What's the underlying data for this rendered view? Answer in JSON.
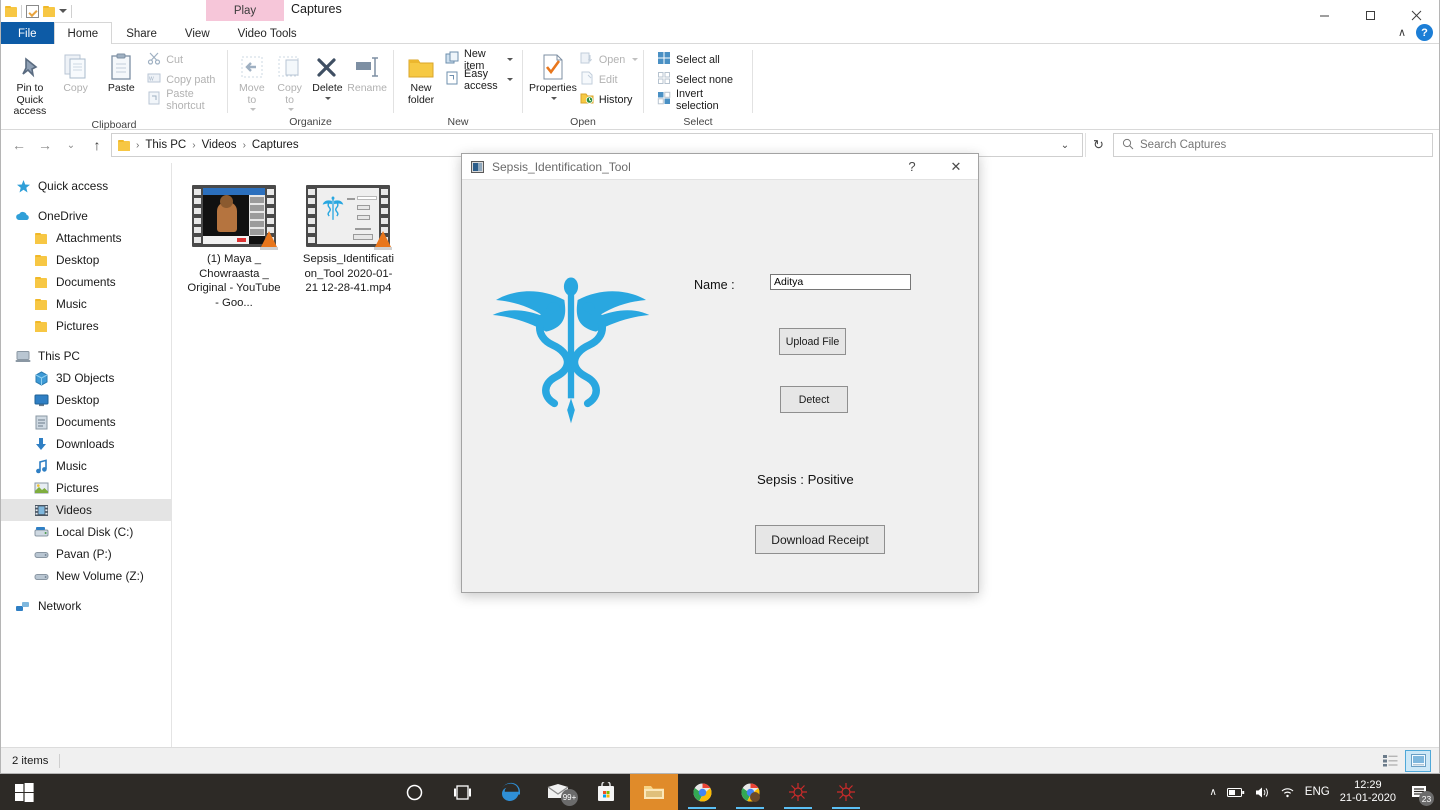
{
  "window": {
    "title": "Captures",
    "contextual_tab_group": "Play",
    "controls": {
      "minimize": "—",
      "maximize": "❐",
      "close": "✕",
      "collapse_ribbon": "∧",
      "help": "?"
    },
    "quick_access": [
      "folder-icon",
      "properties-check-icon",
      "new-folder-icon",
      "customize-caret-icon"
    ]
  },
  "tabs": [
    {
      "label": "File",
      "kind": "file"
    },
    {
      "label": "Home",
      "kind": "active"
    },
    {
      "label": "Share",
      "kind": "normal"
    },
    {
      "label": "View",
      "kind": "normal"
    },
    {
      "label": "Video Tools",
      "kind": "contextual"
    }
  ],
  "ribbon": {
    "groups": [
      {
        "label": "Clipboard",
        "big_buttons": [
          {
            "label": "Pin to Quick access",
            "icon": "pin-icon",
            "disabled": false
          },
          {
            "label": "Copy",
            "icon": "copy-icon",
            "disabled": true
          },
          {
            "label": "Paste",
            "icon": "paste-icon",
            "disabled": false
          }
        ],
        "small_buttons": [
          {
            "label": "Cut",
            "icon": "scissors-icon",
            "disabled": true
          },
          {
            "label": "Copy path",
            "icon": "copy-path-icon",
            "disabled": true
          },
          {
            "label": "Paste shortcut",
            "icon": "paste-shortcut-icon",
            "disabled": true
          }
        ]
      },
      {
        "label": "Organize",
        "big_buttons": [
          {
            "label": "Move to",
            "icon": "move-to-icon",
            "disabled": true,
            "caret": true
          },
          {
            "label": "Copy to",
            "icon": "copy-to-icon",
            "disabled": true,
            "caret": true
          },
          {
            "label": "Delete",
            "icon": "delete-x-icon",
            "disabled": false,
            "caret": true
          },
          {
            "label": "Rename",
            "icon": "rename-icon",
            "disabled": true
          }
        ],
        "small_buttons": []
      },
      {
        "label": "New",
        "big_buttons": [
          {
            "label": "New folder",
            "icon": "new-folder-icon",
            "disabled": false
          }
        ],
        "small_buttons": [
          {
            "label": "New item",
            "icon": "new-item-icon",
            "disabled": false,
            "caret": true
          },
          {
            "label": "Easy access",
            "icon": "easy-access-icon",
            "disabled": false,
            "caret": true
          }
        ]
      },
      {
        "label": "Open",
        "big_buttons": [
          {
            "label": "Properties",
            "icon": "properties-icon",
            "disabled": false,
            "caret": true
          }
        ],
        "small_buttons": [
          {
            "label": "Open",
            "icon": "open-icon",
            "disabled": true,
            "caret": true
          },
          {
            "label": "Edit",
            "icon": "edit-icon",
            "disabled": true
          },
          {
            "label": "History",
            "icon": "history-icon",
            "disabled": false
          }
        ]
      },
      {
        "label": "Select",
        "big_buttons": [],
        "small_buttons": [
          {
            "label": "Select all",
            "icon": "select-all-icon",
            "disabled": false
          },
          {
            "label": "Select none",
            "icon": "select-none-icon",
            "disabled": false
          },
          {
            "label": "Invert selection",
            "icon": "invert-selection-icon",
            "disabled": false
          }
        ]
      }
    ]
  },
  "address_bar": {
    "back": "←",
    "forward": "→",
    "recent": "⌄",
    "up": "↑",
    "breadcrumbs": [
      "This PC",
      "Videos",
      "Captures"
    ],
    "separator": "›",
    "dropdown": "⌄",
    "refresh": "↻",
    "search_placeholder": "Search Captures",
    "search_value": ""
  },
  "nav_pane": {
    "items": [
      {
        "label": "Quick access",
        "icon": "star-icon",
        "level": 0,
        "selected": false,
        "gap": false
      },
      {
        "label": "OneDrive",
        "icon": "cloud-icon",
        "level": 0,
        "selected": false,
        "gap": true
      },
      {
        "label": "Attachments",
        "icon": "folder-icon",
        "level": 1,
        "selected": false,
        "gap": false
      },
      {
        "label": "Desktop",
        "icon": "folder-icon",
        "level": 1,
        "selected": false,
        "gap": false
      },
      {
        "label": "Documents",
        "icon": "folder-icon",
        "level": 1,
        "selected": false,
        "gap": false
      },
      {
        "label": "Music",
        "icon": "folder-icon",
        "level": 1,
        "selected": false,
        "gap": false
      },
      {
        "label": "Pictures",
        "icon": "folder-icon",
        "level": 1,
        "selected": false,
        "gap": false
      },
      {
        "label": "This PC",
        "icon": "this-pc-icon",
        "level": 0,
        "selected": false,
        "gap": true
      },
      {
        "label": "3D Objects",
        "icon": "3d-objects-icon",
        "level": 1,
        "selected": false,
        "gap": false
      },
      {
        "label": "Desktop",
        "icon": "desktop-monitor-icon",
        "level": 1,
        "selected": false,
        "gap": false
      },
      {
        "label": "Documents",
        "icon": "documents-icon",
        "level": 1,
        "selected": false,
        "gap": false
      },
      {
        "label": "Downloads",
        "icon": "download-arrow-icon",
        "level": 1,
        "selected": false,
        "gap": false
      },
      {
        "label": "Music",
        "icon": "music-note-icon",
        "level": 1,
        "selected": false,
        "gap": false
      },
      {
        "label": "Pictures",
        "icon": "pictures-icon",
        "level": 1,
        "selected": false,
        "gap": false
      },
      {
        "label": "Videos",
        "icon": "videos-icon",
        "level": 1,
        "selected": true,
        "gap": false
      },
      {
        "label": "Local Disk (C:)",
        "icon": "local-disk-icon",
        "level": 1,
        "selected": false,
        "gap": false
      },
      {
        "label": "Pavan (P:)",
        "icon": "drive-icon",
        "level": 1,
        "selected": false,
        "gap": false
      },
      {
        "label": "New Volume (Z:)",
        "icon": "drive-icon",
        "level": 1,
        "selected": false,
        "gap": false
      },
      {
        "label": "Network",
        "icon": "network-icon",
        "level": 0,
        "selected": false,
        "gap": true
      }
    ]
  },
  "files": [
    {
      "name": "(1) Maya _ Chowraasta _ Original - YouTube - Goo...",
      "type": "video",
      "thumb": "youtube-video-thumb"
    },
    {
      "name": "Sepsis_Identification_Tool 2020-01-21 12-28-41.mp4",
      "type": "video",
      "thumb": "sepsis-app-thumb"
    }
  ],
  "status_bar": {
    "item_count": "2 items",
    "views": [
      {
        "name": "details-view",
        "selected": false
      },
      {
        "name": "large-icons-view",
        "selected": true
      }
    ]
  },
  "dialog": {
    "title": "Sepsis_Identification_Tool",
    "help_button": "?",
    "close_button": "✕",
    "logo": "caduceus-medical-icon",
    "logo_color": "#29a7e0",
    "name_label": "Name :",
    "name_value": "Aditya",
    "name_placeholder": "",
    "upload_button": "Upload File",
    "detect_button": "Detect",
    "result_text": "Sepsis : Positive",
    "download_button": "Download Receipt"
  },
  "taskbar": {
    "start": "windows-logo-icon",
    "items": [
      {
        "name": "cortana-icon",
        "state": "idle"
      },
      {
        "name": "task-view-icon",
        "state": "idle"
      },
      {
        "name": "edge-icon",
        "state": "idle"
      },
      {
        "name": "mail-icon",
        "state": "idle",
        "badge": "99+"
      },
      {
        "name": "microsoft-store-icon",
        "state": "idle"
      },
      {
        "name": "file-explorer-icon",
        "state": "active"
      },
      {
        "name": "chrome-icon",
        "state": "open"
      },
      {
        "name": "chrome-profile-icon",
        "state": "open"
      },
      {
        "name": "spyder-icon",
        "state": "open"
      },
      {
        "name": "spyder-2-icon",
        "state": "open"
      }
    ],
    "tray": {
      "show_hidden": "∧",
      "battery": "battery-icon",
      "volume": "volume-icon",
      "network": "wifi-icon",
      "language": "ENG",
      "time": "12:29",
      "date": "21-01-2020",
      "notifications": "notification-icon",
      "notification_count": "23"
    }
  }
}
